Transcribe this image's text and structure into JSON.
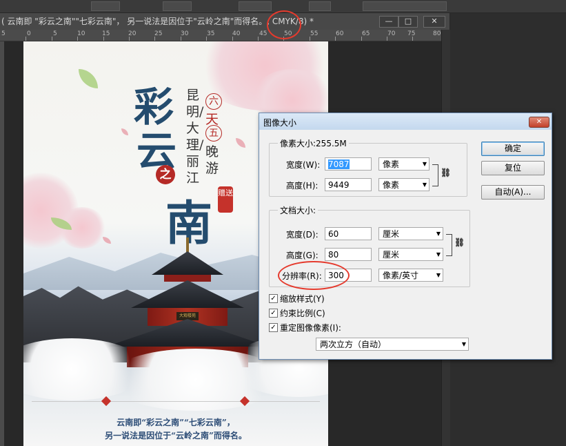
{
  "window": {
    "title": "( 云南即 \"彩云之南\"\"七彩云南\"， 另一说法是因位于\"云岭之南\"而得名。, CMYK/8) *",
    "min_btn": "—",
    "max_btn": "□",
    "close_btn": "✕"
  },
  "ruler": {
    "labels": [
      "5",
      "0",
      "5",
      "10",
      "15",
      "20",
      "25",
      "30",
      "35",
      "40",
      "45",
      "50",
      "55",
      "60",
      "65",
      "70",
      "75",
      "80"
    ]
  },
  "poster": {
    "big_char_1": "彩",
    "big_char_2": "云",
    "seal_char": "之",
    "big_char_3": "南",
    "route": "昆明/大理/丽江",
    "trip_char_1": "六",
    "trip_char_2": "天",
    "trip_char_3": "五",
    "trip_char_4": "晚",
    "trip_char_5": "游",
    "gift": "赠送",
    "plaque": "大观楼苑",
    "caption_line1": "云南即“彩云之南”“七彩云南”，",
    "caption_line2": "另一说法是因位于“云岭之南”而得名。"
  },
  "dialog": {
    "title": "图像大小",
    "close": "✕",
    "pixel_group": {
      "legend": "像素大小:255.5M",
      "width_label": "宽度(W):",
      "width_value": "7087",
      "width_unit": "像素",
      "height_label": "高度(H):",
      "height_value": "9449",
      "height_unit": "像素"
    },
    "doc_group": {
      "legend": "文档大小:",
      "width_label": "宽度(D):",
      "width_value": "60",
      "width_unit": "厘米",
      "height_label": "高度(G):",
      "height_value": "80",
      "height_unit": "厘米",
      "res_label": "分辨率(R):",
      "res_value": "300",
      "res_unit": "像素/英寸"
    },
    "checkboxes": {
      "scale_styles": "缩放样式(Y)",
      "constrain": "约束比例(C)",
      "resample": "重定图像像素(I):",
      "check_mark": "✓"
    },
    "resample_method": "两次立方（自动）",
    "buttons": {
      "ok": "确定",
      "reset": "复位",
      "auto": "自动(A)..."
    },
    "chain_icon": "⛓"
  },
  "annotations": {
    "ring_color": "#e53a2d"
  }
}
